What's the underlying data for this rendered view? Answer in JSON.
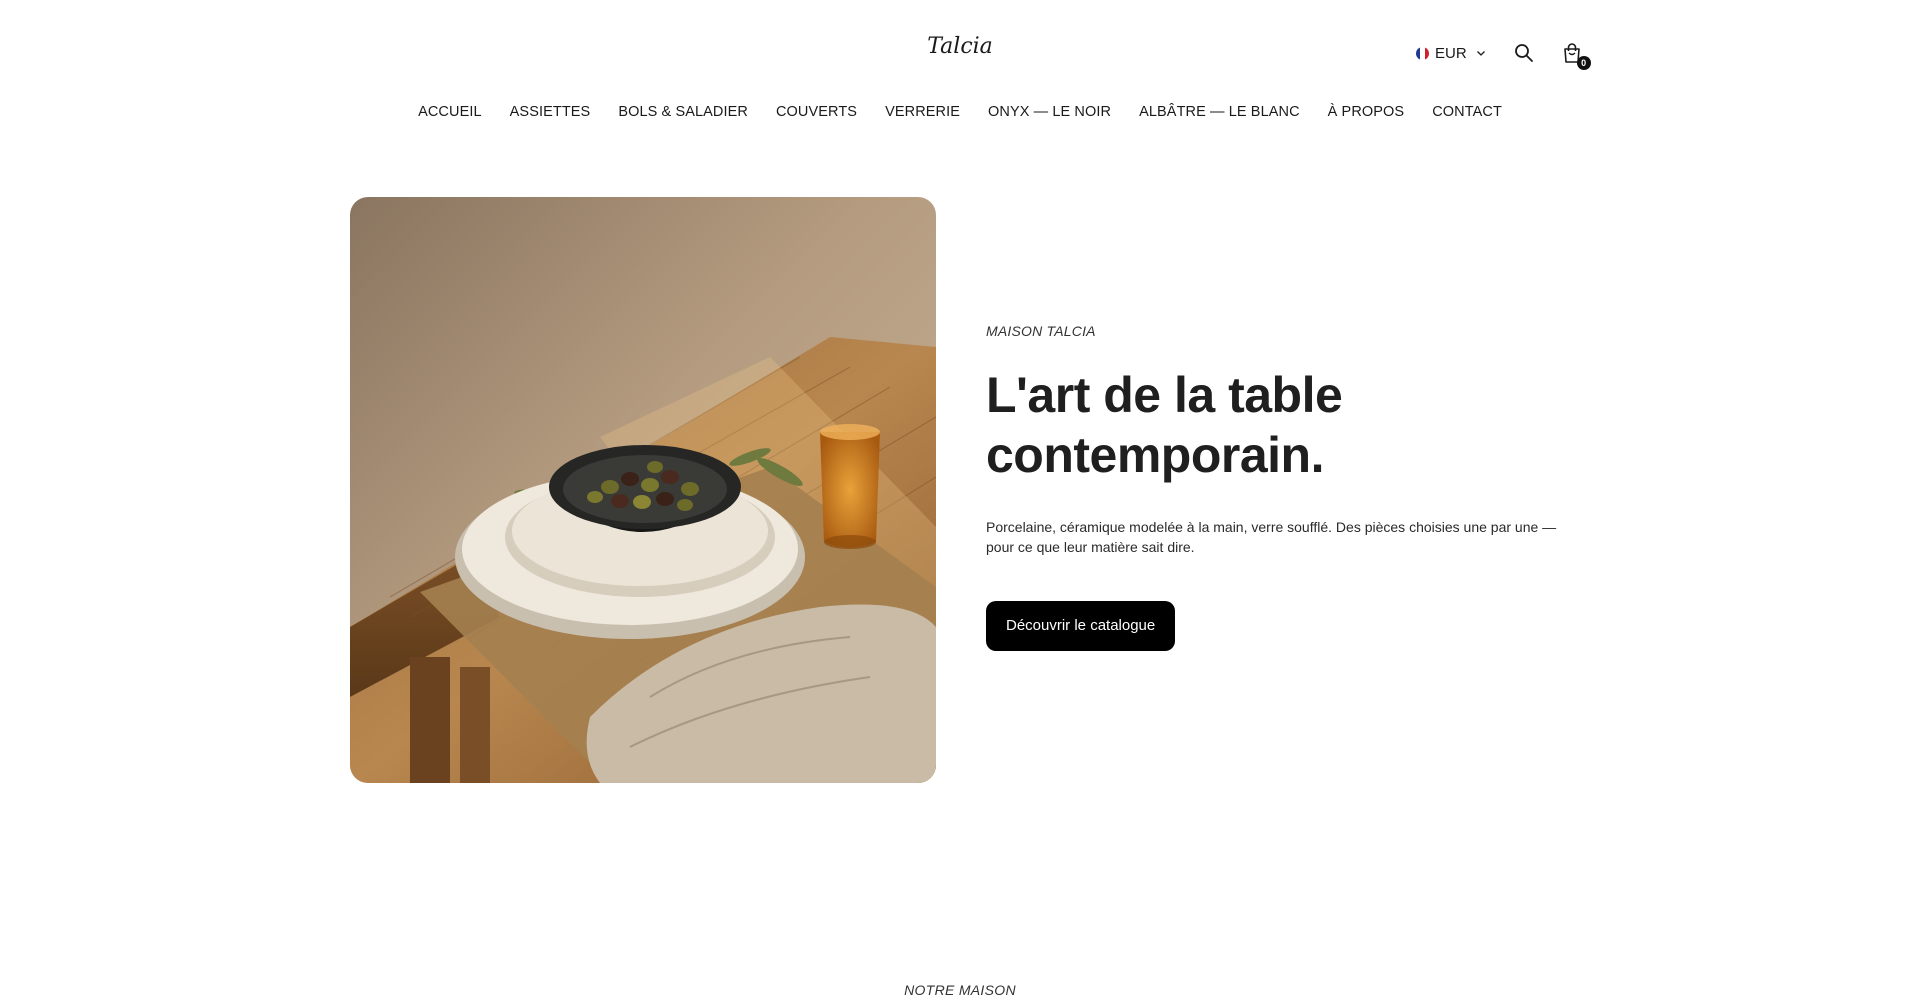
{
  "header": {
    "logo": "Talcia",
    "currency": {
      "label": "EUR",
      "flag": [
        "#1f3a93",
        "#ffffff",
        "#d0202e"
      ]
    },
    "cart": {
      "count": "0"
    }
  },
  "nav": {
    "items": [
      "ACCUEIL",
      "ASSIETTES",
      "BOLS & SALADIER",
      "COUVERTS",
      "VERRERIE",
      "ONYX — LE NOIR",
      "ALBÂTRE — LE BLANC",
      "À PROPOS",
      "CONTACT"
    ]
  },
  "hero": {
    "eyebrow": "MAISON TALCIA",
    "headline": "L'art de la table contemporain.",
    "description": "Porcelaine, céramique modelée à la main, verre soufflé. Des pièces choisies une par une — pour ce que leur matière sait dire.",
    "cta_label": "Découvrir le catalogue"
  },
  "next_section": {
    "eyebrow": "NOTRE MAISON"
  },
  "colors": {
    "accent": "#000000",
    "text": "#1a1a1a",
    "background": "#ffffff"
  },
  "icons": [
    "chevron-down-icon",
    "search-icon",
    "shopping-bag-icon"
  ]
}
